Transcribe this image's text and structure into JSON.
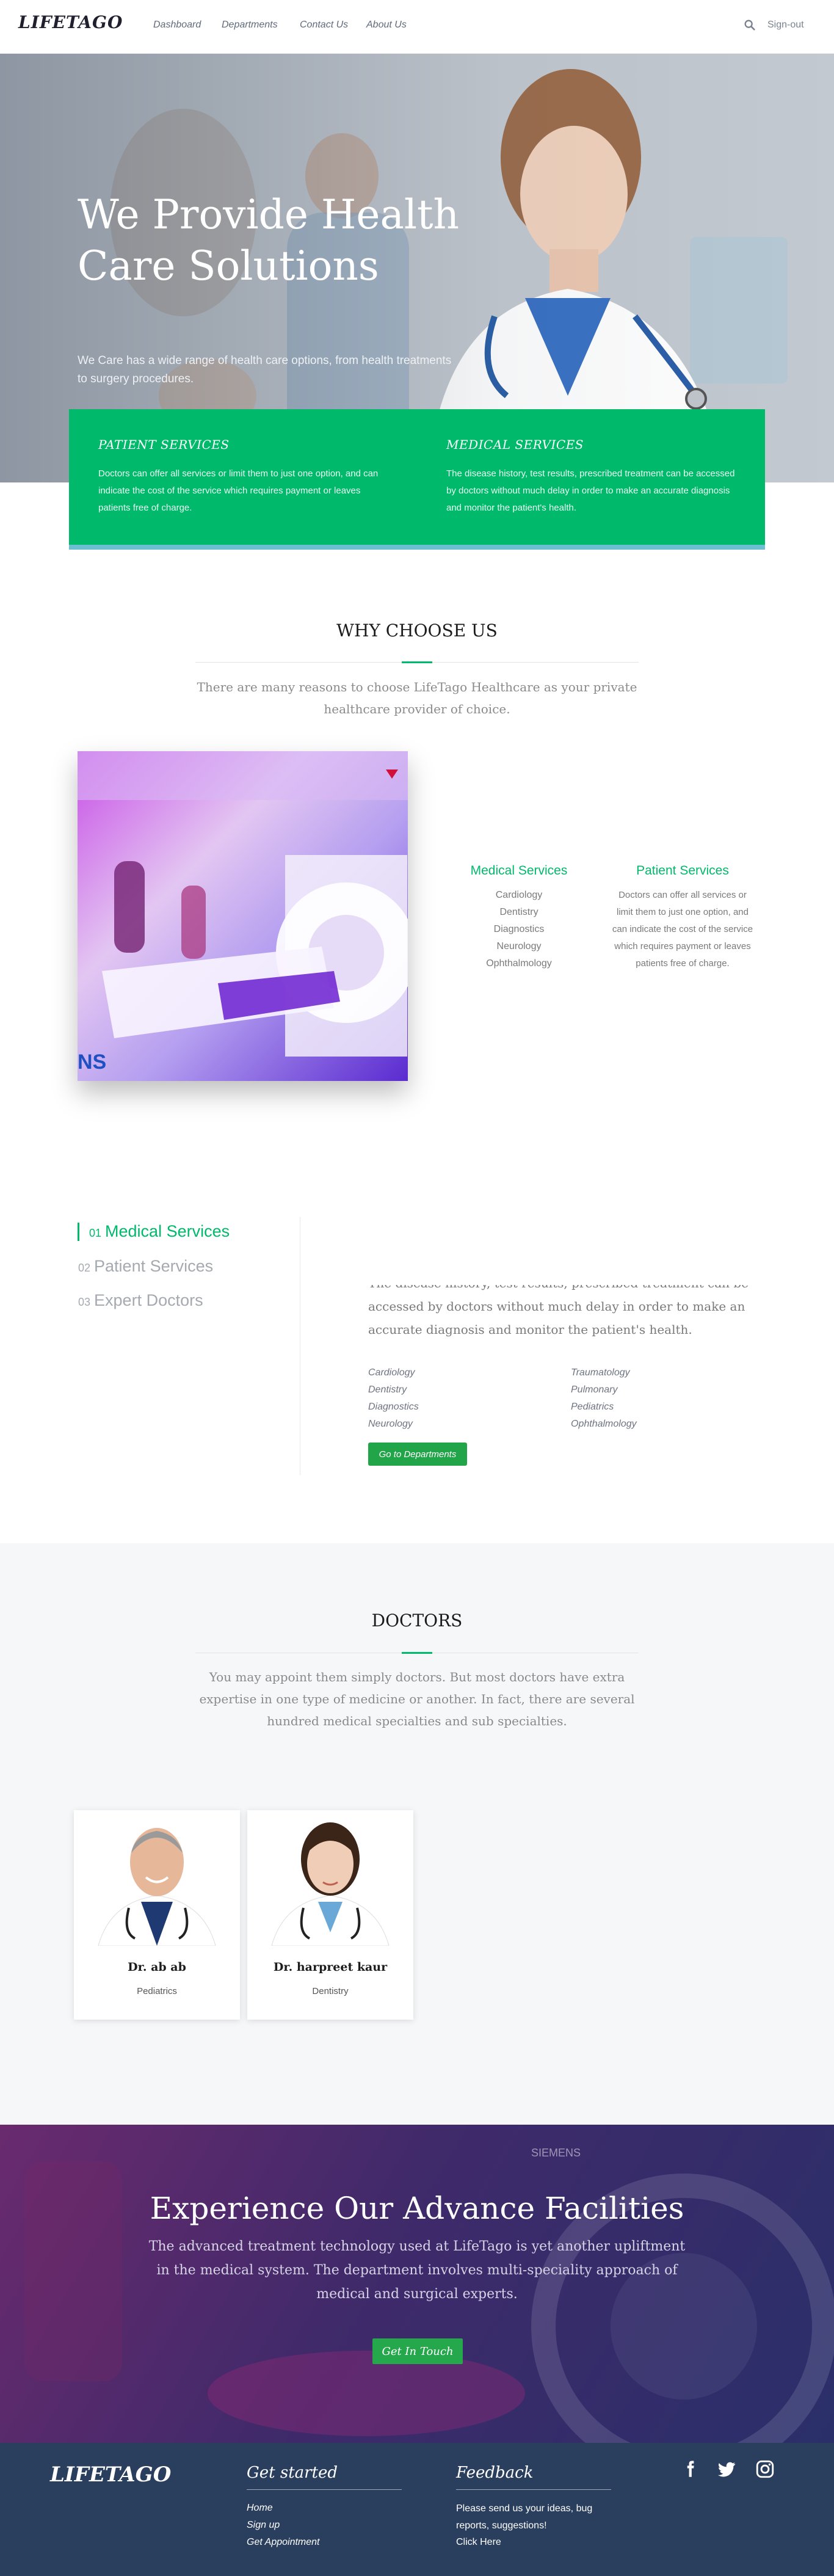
{
  "nav": {
    "logo": "LIFETAGO",
    "links": [
      "Dashboard",
      "Departments",
      "Contact Us",
      "About Us"
    ],
    "signout": "Sign-out"
  },
  "hero": {
    "title": "We Provide Health Care Solutions",
    "subtitle": "We Care has a wide range of health care options, from health treatments to surgery procedures."
  },
  "services_band": {
    "patient_title": "PATIENT SERVICES",
    "patient_text": "Doctors can offer all services or limit them to just one option, and can indicate the cost of the service which requires payment or leaves patients free of charge.",
    "medical_title": "MEDICAL SERVICES",
    "medical_text": "The disease history, test results, prescribed treatment can be accessed by doctors without much delay in order to make an accurate diagnosis and monitor the patient's health."
  },
  "why": {
    "title": "WHY CHOOSE US",
    "lead": "There are many reasons to choose LifeTago Healthcare as your private healthcare provider of choice.",
    "medical_title": "Medical Services",
    "medical_items": [
      "Cardiology",
      "Dentistry",
      "Diagnostics",
      "Neurology",
      "Ophthalmology"
    ],
    "patient_title": "Patient Services",
    "patient_text": "Doctors can offer all services or limit them to just one option, and can indicate the cost of the service which requires payment or leaves patients free of charge."
  },
  "tabs": {
    "items": [
      {
        "num": "01",
        "label": "Medical Services"
      },
      {
        "num": "02",
        "label": "Patient Services"
      },
      {
        "num": "03",
        "label": "Expert Doctors"
      }
    ],
    "text": "The disease history, test results, prescribed treatment can be accessed by doctors without much delay in order to make an accurate diagnosis and monitor the patient's health.",
    "depts_left": [
      "Cardiology",
      "Dentistry",
      "Diagnostics",
      "Neurology"
    ],
    "depts_right": [
      "Traumatology",
      "Pulmonary",
      "Pediatrics",
      "Ophthalmology"
    ],
    "button": "Go to Departments"
  },
  "doctors": {
    "title": "DOCTORS",
    "lead": "You may appoint them simply doctors. But most doctors have extra expertise in one type of medicine or another. In fact, there are several hundred medical specialties and sub specialties.",
    "cards": [
      {
        "name": "Dr. ab ab",
        "specialty": "Pediatrics"
      },
      {
        "name": "Dr. harpreet kaur",
        "specialty": "Dentistry"
      }
    ]
  },
  "facilities": {
    "title": "Experience Our Advance Facilities",
    "text": "The advanced treatment technology used at LifeTago is yet another upliftment in the medical system. The department involves multi-speciality approach of medical and surgical experts.",
    "button": "Get In Touch"
  },
  "footer": {
    "logo": "LIFETAGO",
    "started_title": "Get started",
    "started_links": [
      "Home",
      "Sign up",
      "Get Appointment"
    ],
    "feedback_title": "Feedback",
    "feedback_text": "Please send us your ideas, bug reports, suggestions!",
    "feedback_link": "Click Here"
  }
}
